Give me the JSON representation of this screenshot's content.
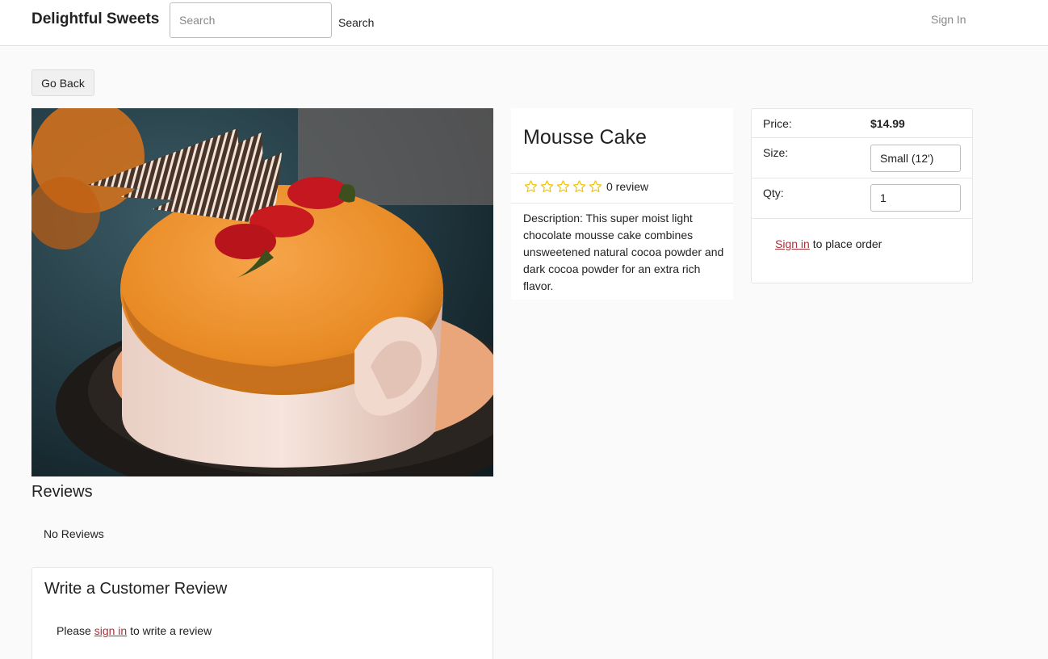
{
  "header": {
    "brand": "Delightful Sweets",
    "search_placeholder": "Search",
    "search_button": "Search",
    "sign_in": "Sign In"
  },
  "actions": {
    "go_back": "Go Back"
  },
  "product": {
    "title": "Mousse Cake",
    "rating": 0,
    "review_count_text": "0 review",
    "description": "Description: This super moist light chocolate mousse cake combines unsweetened natural cocoa powder and dark cocoa powder for an extra rich flavor.",
    "star_color": "#f2c200"
  },
  "order": {
    "price_label": "Price:",
    "price_value": "$14.99",
    "size_label": "Size:",
    "size_value": "Small (12')",
    "qty_label": "Qty:",
    "qty_value": "1",
    "signin_link": "Sign in",
    "signin_suffix": "to place order"
  },
  "reviews": {
    "heading": "Reviews",
    "empty_text": "No Reviews",
    "write_heading": "Write a Customer Review",
    "write_prefix": "Please",
    "write_link": "sign in",
    "write_suffix": "to write a review"
  },
  "colors": {
    "link": "#a8323a",
    "accent_star": "#f2c200"
  }
}
